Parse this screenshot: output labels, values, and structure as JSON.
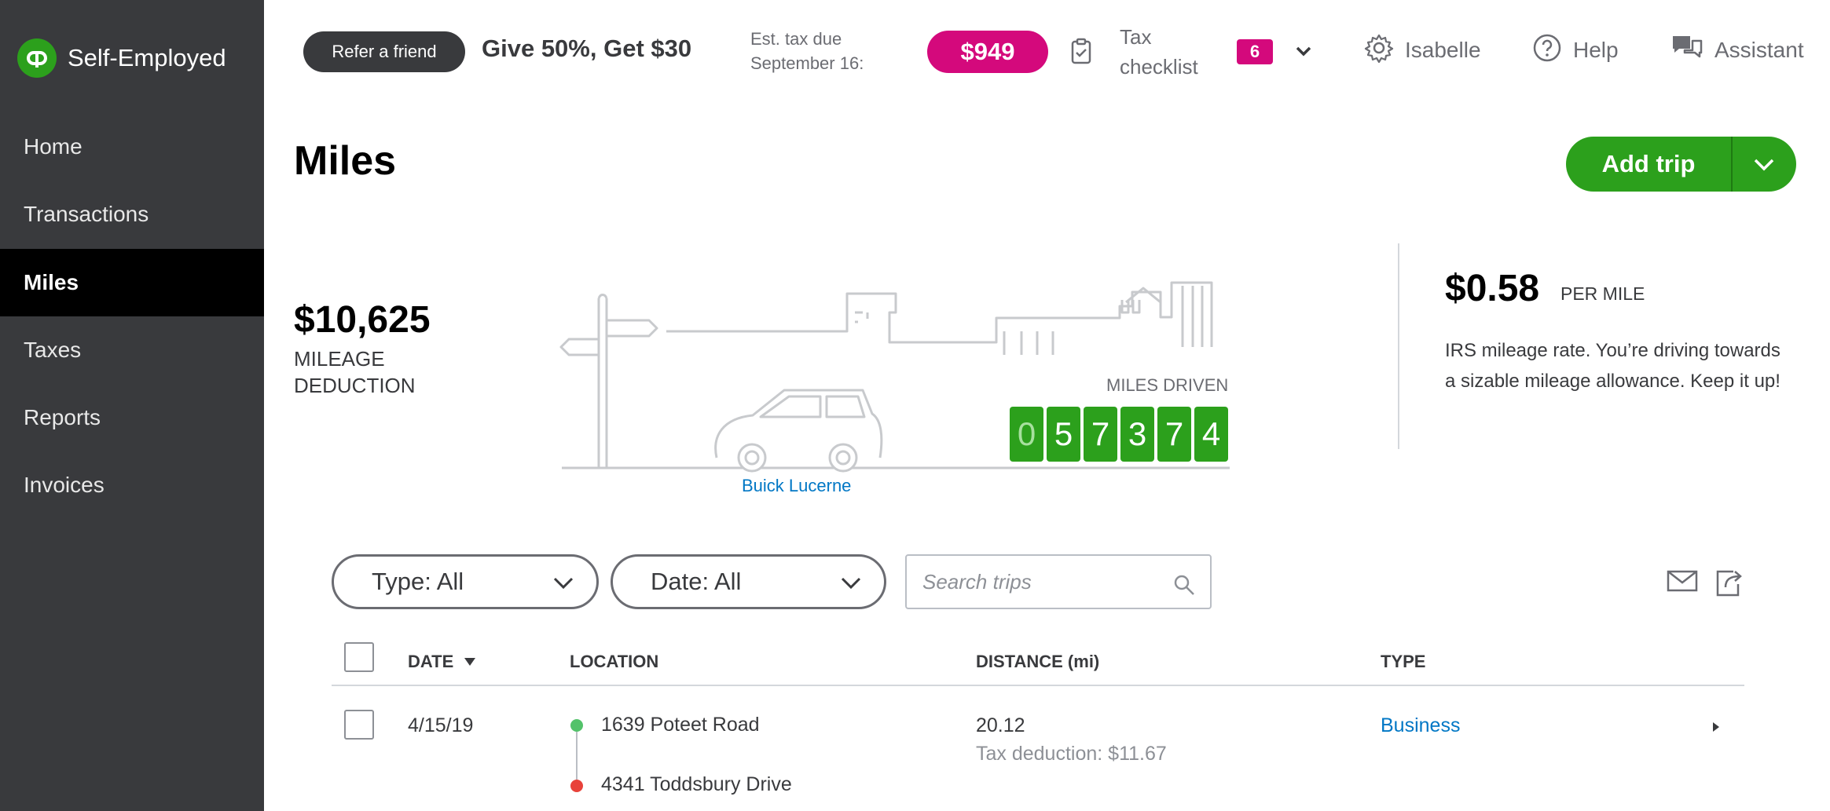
{
  "app": {
    "name": "Self-Employed",
    "logo_text": "qb"
  },
  "sidebar": {
    "items": [
      {
        "label": "Home",
        "active": false
      },
      {
        "label": "Transactions",
        "active": false
      },
      {
        "label": "Miles",
        "active": true
      },
      {
        "label": "Taxes",
        "active": false
      },
      {
        "label": "Reports",
        "active": false
      },
      {
        "label": "Invoices",
        "active": false
      }
    ]
  },
  "topbar": {
    "refer_label": "Refer a friend",
    "promo_text": "Give 50%, Get $30",
    "tax_due_line1": "Est. tax due",
    "tax_due_line2": "September 16:",
    "tax_due_amount": "$949",
    "checklist_line1": "Tax",
    "checklist_line2": "checklist",
    "checklist_count": "6",
    "settings_label": "Isabelle",
    "help_label": "Help",
    "assistant_label": "Assistant"
  },
  "page": {
    "title": "Miles",
    "add_trip_label": "Add trip"
  },
  "summary": {
    "deduction_amount": "$10,625",
    "deduction_label_line1": "MILEAGE",
    "deduction_label_line2": "DEDUCTION",
    "miles_driven_label": "MILES DRIVEN",
    "odometer_digits": [
      "0",
      "5",
      "7",
      "3",
      "7",
      "4"
    ],
    "vehicle_name": "Buick Lucerne",
    "rate_value": "$0.58",
    "rate_unit": "PER MILE",
    "rate_description": "IRS mileage rate. You’re driving towards a sizable mileage allowance. Keep it up!"
  },
  "filters": {
    "type_label": "Type: All",
    "date_label": "Date: All",
    "search_placeholder": "Search trips"
  },
  "table": {
    "headers": {
      "date": "DATE",
      "location": "LOCATION",
      "distance": "DISTANCE (mi)",
      "type": "TYPE"
    },
    "rows": [
      {
        "date": "4/15/19",
        "start_location": "1639 Poteet Road",
        "end_location": "4341 Toddsbury Drive",
        "distance": "20.12",
        "tax_deduction": "Tax deduction: $11.67",
        "type": "Business"
      }
    ]
  },
  "colors": {
    "sidebar_bg": "#393a3d",
    "brand_green": "#2ca01c",
    "accent_magenta": "#d4097c",
    "link_blue": "#0077c5",
    "start_dot": "#53c26a",
    "end_dot": "#e8423a"
  },
  "icons": [
    "quickbooks-logo",
    "clipboard-icon",
    "chevron-down-icon",
    "gear-icon",
    "help-icon",
    "chat-icon",
    "search-icon",
    "mail-icon",
    "export-icon",
    "sort-desc-icon",
    "caret-right-icon"
  ]
}
